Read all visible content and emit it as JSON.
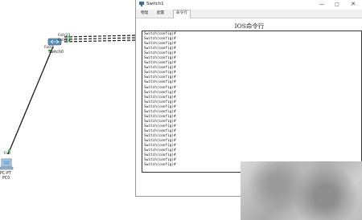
{
  "topology": {
    "switch": {
      "name": "Switch0",
      "ports": [
        "Fa0/23",
        "Fa0/24",
        "Fa0/1"
      ],
      "icon": "switch-icon"
    },
    "pc": {
      "name": "PC0",
      "model": "PC-PT",
      "port": "Fa0",
      "icon": "pc-icon"
    }
  },
  "window": {
    "title": "Switch1",
    "tabs": [
      "物理",
      "配置",
      "命令行"
    ],
    "active_tab": 2,
    "controls": {
      "minimize": "—",
      "maximize": "□",
      "close": "✕"
    }
  },
  "cli": {
    "heading": "IOS命令行",
    "lines": [
      "Switch(config)#",
      "Switch(config)#",
      "Switch(config)#",
      "Switch(config)#",
      "Switch(config)#",
      "Switch(config)#",
      "Switch(config)#",
      "Switch(config)#",
      "Switch(config)#",
      "Switch(config)#",
      "Switch(config)#",
      "Switch(config)#",
      "Switch(config)#",
      "Switch(config)#",
      "Switch(config)#",
      "Switch(config)#",
      "Switch(config)#",
      "Switch(config)#",
      "Switch(config)#",
      "Switch(config)#",
      "Switch(config)#",
      "Switch(config)#",
      "Switch(config)#",
      "Switch(config)#",
      "Switch(config)#",
      "Switch(config)#",
      "Switch(config)#",
      "Switch(config)#"
    ]
  },
  "colors": {
    "link": "#1a1a1a",
    "port_dot": "#2ecc40",
    "switch_body": "#5b8fb9"
  }
}
